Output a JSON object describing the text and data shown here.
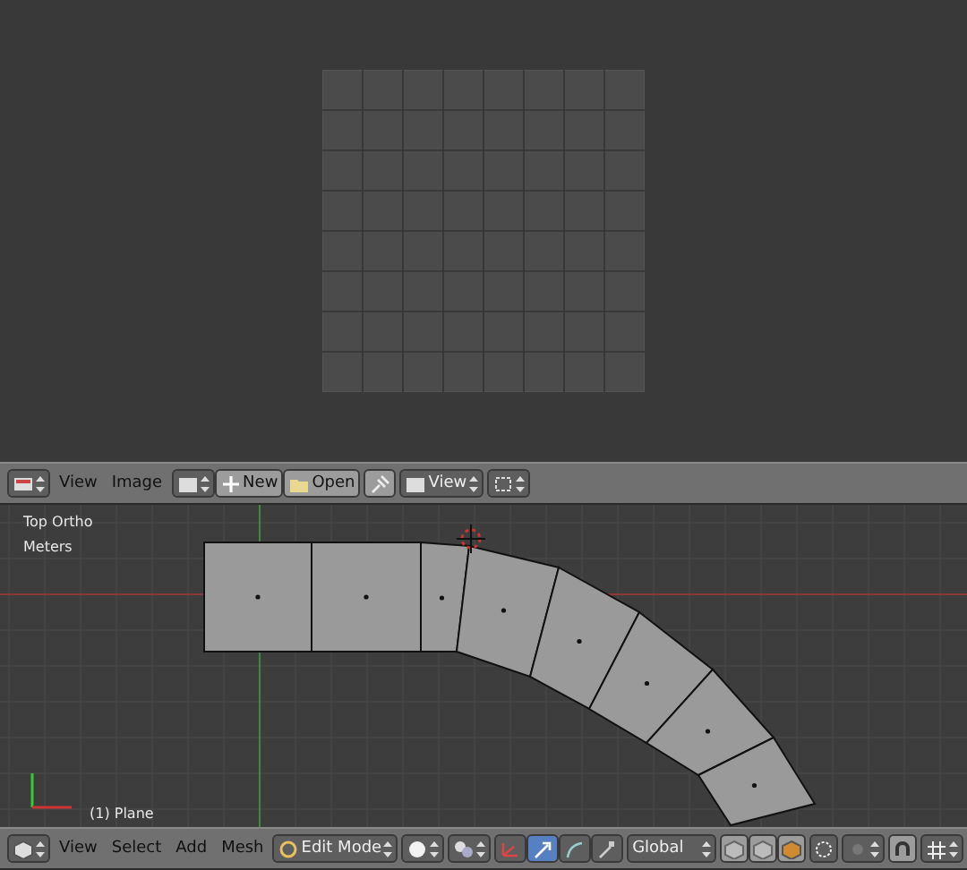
{
  "uv_editor": {
    "header": {
      "menus": [
        {
          "label": "View"
        },
        {
          "label": "Image"
        }
      ],
      "buttons": [
        {
          "kind": "new",
          "label": "New"
        },
        {
          "kind": "open",
          "label": "Open"
        }
      ],
      "view_dropdown": "View"
    }
  },
  "viewport": {
    "view_name": "Top Ortho",
    "units": "Meters",
    "object_label": "(1) Plane",
    "header": {
      "menus": [
        {
          "label": "View"
        },
        {
          "label": "Select"
        },
        {
          "label": "Add"
        },
        {
          "label": "Mesh"
        }
      ],
      "mode": "Edit Mode",
      "orientation": "Global",
      "manipulators": [
        {
          "kind": "axes",
          "on": false
        },
        {
          "kind": "translate",
          "on": true
        },
        {
          "kind": "rotate",
          "on": false
        },
        {
          "kind": "scale",
          "on": false
        }
      ]
    }
  }
}
